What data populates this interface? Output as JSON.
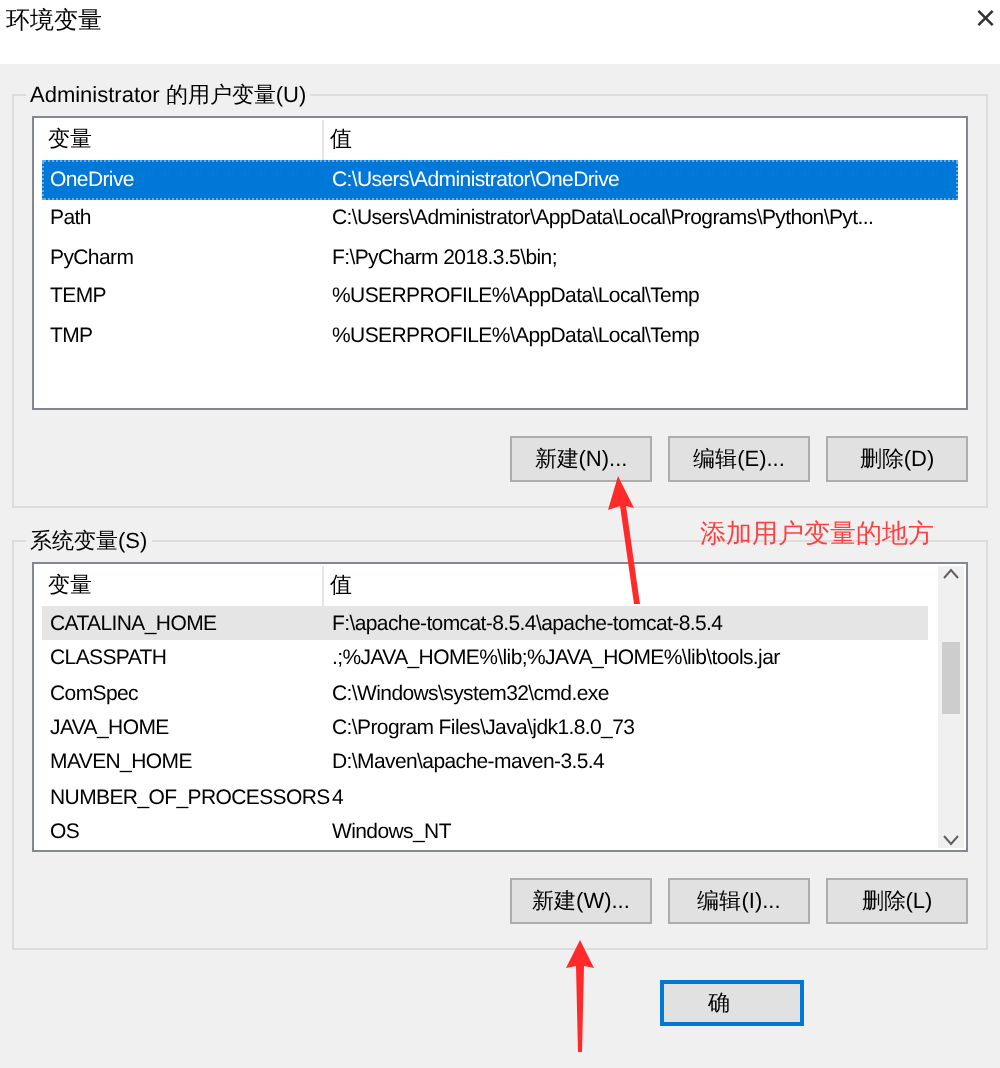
{
  "window": {
    "title": "环境变量",
    "close": "×"
  },
  "user_group": {
    "label": "Administrator 的用户变量(U)",
    "columns": [
      "变量",
      "值"
    ],
    "rows": [
      {
        "name": "OneDrive",
        "value": "C:\\Users\\Administrator\\OneDrive",
        "selected": true,
        "highlighted": false
      },
      {
        "name": "Path",
        "value": "C:\\Users\\Administrator\\AppData\\Local\\Programs\\Python\\Pyt...",
        "selected": false,
        "highlighted": false
      },
      {
        "name": "PyCharm",
        "value": "F:\\PyCharm 2018.3.5\\bin;",
        "selected": false,
        "highlighted": false
      },
      {
        "name": "TEMP",
        "value": "%USERPROFILE%\\AppData\\Local\\Temp",
        "selected": false,
        "highlighted": false
      },
      {
        "name": "TMP",
        "value": "%USERPROFILE%\\AppData\\Local\\Temp",
        "selected": false,
        "highlighted": false
      }
    ],
    "buttons": [
      "新建(N)...",
      "编辑(E)...",
      "删除(D)"
    ]
  },
  "annotation": "添加用户变量的地方",
  "system_group": {
    "label": "系统变量(S)",
    "columns": [
      "变量",
      "值"
    ],
    "rows": [
      {
        "name": "CATALINA_HOME",
        "value": "F:\\apache-tomcat-8.5.4\\apache-tomcat-8.5.4",
        "selected": false,
        "highlighted": true
      },
      {
        "name": "CLASSPATH",
        "value": ".;%JAVA_HOME%\\lib;%JAVA_HOME%\\lib\\tools.jar",
        "selected": false,
        "highlighted": false
      },
      {
        "name": "ComSpec",
        "value": "C:\\Windows\\system32\\cmd.exe",
        "selected": false,
        "highlighted": false
      },
      {
        "name": "JAVA_HOME",
        "value": "C:\\Program Files\\Java\\jdk1.8.0_73",
        "selected": false,
        "highlighted": false
      },
      {
        "name": "MAVEN_HOME",
        "value": "D:\\Maven\\apache-maven-3.5.4",
        "selected": false,
        "highlighted": false
      },
      {
        "name": "NUMBER_OF_PROCESSORS",
        "value": "4",
        "selected": false,
        "highlighted": false
      },
      {
        "name": "OS",
        "value": "Windows_NT",
        "selected": false,
        "highlighted": false
      }
    ],
    "buttons": [
      "新建(W)...",
      "编辑(I)...",
      "删除(L)"
    ]
  },
  "ok_button": "确"
}
